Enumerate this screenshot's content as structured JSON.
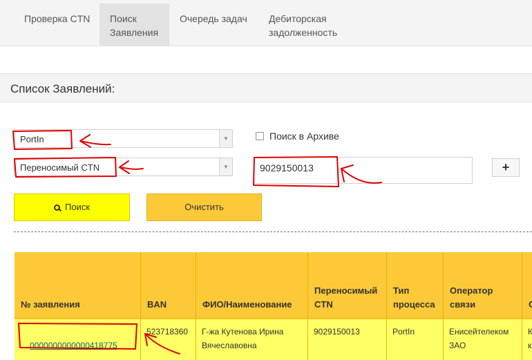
{
  "nav": {
    "tabs": [
      {
        "label": "Проверка CTN"
      },
      {
        "label": "Поиск\nЗаявления"
      },
      {
        "label": "Очередь задач"
      },
      {
        "label": "Дебиторская\nзадолженность"
      }
    ]
  },
  "section": {
    "title": "Список Заявлений:"
  },
  "filters": {
    "process_type": "PortIn",
    "search_field": "Переносимый CTN",
    "archive_label": "Поиск в Архиве",
    "archive_checked": false,
    "query_value": "9029150013",
    "add_label": "+"
  },
  "buttons": {
    "search": "Поиск",
    "clear": "Очистить"
  },
  "table": {
    "headers": [
      "№ заявления",
      "BAN",
      "ФИО/Наименование",
      "Переносимый\nCTN",
      "Тип\nпроцесса",
      "Оператор\nсвязи",
      "С"
    ],
    "rows": [
      {
        "id": "0000000000000418775",
        "ban": "523718360",
        "name": "Г-жа Кутенова Ирина\nВячеславовна",
        "ctn": "9029150013",
        "type": "PortIn",
        "operator": "Енисейтелеком\nЗАО",
        "extra": "К\nк"
      }
    ]
  },
  "colors": {
    "nav_bg": "#f4f4f4",
    "search_btn": "#ffff00",
    "clear_btn": "#fcc938",
    "header_bg": "#fcc938",
    "row_bg": "#ffff66",
    "annotation": "#e00000"
  },
  "icons": {
    "search": "search-icon",
    "dropdown": "dropdown-arrow-icon"
  }
}
